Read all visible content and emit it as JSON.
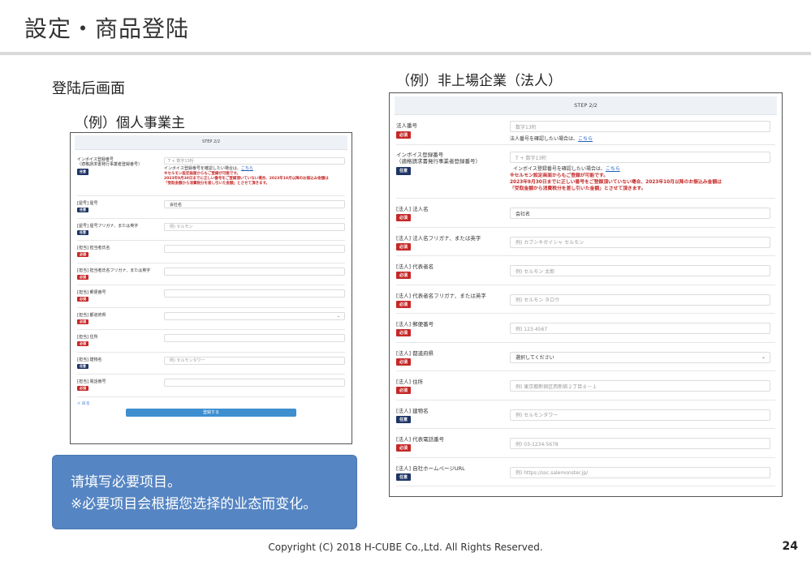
{
  "slide": {
    "title": "設定・商品登陆",
    "subtitle": "登陆后画面",
    "left_caption": "（例）個人事業主",
    "right_caption": "（例）非上場企業（法人）",
    "callout_line1": "请填写必要项目。",
    "callout_line2": "※必要项目会根据您选择的业态而变化。",
    "copyright": "Copyright (C) 2018 H-CUBE Co.,Ltd. All Rights Reserved.",
    "page_number": "24"
  },
  "individual_form": {
    "step": "STEP 2/2",
    "invoice": {
      "label1": "インボイス登録番号",
      "label2": "（適格請求書発行事業者登録番号）",
      "badge": "任意",
      "placeholder": "T + 数字13桁",
      "note": "インボイス登録番号を確認したい場合は、",
      "link": "こちら",
      "warn1": "※セルモン設定画面からもご登録が可能です。",
      "warn2": "2023年9月30日までに正しい番号をご登録頂いていない場合、2023年10月以降のお振込み金額は",
      "warn3": "「受取金額から消費税分を差し引いた金額」とさせて頂きます。"
    },
    "fields": [
      {
        "label": "[屋号] 屋号",
        "badge": "任意",
        "value": "会社名",
        "filled": true
      },
      {
        "label": "[屋号] 屋号フリガナ、または英字",
        "badge": "任意",
        "value": "例) セルモン",
        "filled": false
      },
      {
        "label": "[担当] 担当者氏名",
        "badge": "必須",
        "value": "",
        "filled": false
      },
      {
        "label": "[担当] 担当者氏名フリガナ、または英字",
        "badge": "必須",
        "value": "",
        "filled": false
      },
      {
        "label": "[担当] 郵便番号",
        "badge": "必須",
        "value": "",
        "filled": false
      },
      {
        "label": "[担当] 都道府県",
        "badge": "必須",
        "value": "",
        "filled": false,
        "select": true
      },
      {
        "label": "[担当] 住所",
        "badge": "必須",
        "value": "",
        "filled": false
      },
      {
        "label": "[担当] 建物名",
        "badge": "任意",
        "value": "例) セルモンタワー",
        "filled": false
      },
      {
        "label": "[担当] 電話番号",
        "badge": "必須",
        "value": "",
        "filled": false
      }
    ],
    "back": "< 戻る",
    "submit": "登録する"
  },
  "corporate_form": {
    "step": "STEP 2/2",
    "corp_number": {
      "label": "法人番号",
      "badge": "必須",
      "placeholder": "数字13桁",
      "note": "法人番号を確認したい場合は、",
      "link": "こちら"
    },
    "invoice": {
      "label1": "インボイス登録番号",
      "label2": "（適格請求書発行事業者登録番号）",
      "badge": "任意",
      "placeholder": "T + 数字13桁",
      "note": "インボイス登録番号を確認したい場合は、",
      "link": "こちら",
      "warn1": "※セルモン設定画面からもご登録が可能です。",
      "warn2": "2023年9月30日までに正しい番号をご登録頂いていない場合、2023年10月以降のお振込み金額は",
      "warn3": "「受取金額から消費税分を差し引いた金額」とさせて頂きます。"
    },
    "fields": [
      {
        "label": "[法人] 法人名",
        "badge": "必須",
        "value": "会社名",
        "filled": true
      },
      {
        "label": "[法人] 法人名フリガナ、または英字",
        "badge": "必須",
        "value": "例) カブシキガイシャ セルモン",
        "filled": false
      },
      {
        "label": "[法人] 代表者名",
        "badge": "必須",
        "value": "例) セルモン 太郎",
        "filled": false
      },
      {
        "label": "[法人] 代表者名フリガナ、または英字",
        "badge": "必須",
        "value": "例) セルモン タロウ",
        "filled": false
      },
      {
        "label": "[法人] 郵便番号",
        "badge": "必須",
        "value": "例) 123-4567",
        "filled": false
      },
      {
        "label": "[法人] 都道府県",
        "badge": "必須",
        "value": "選択してください",
        "filled": true,
        "select": true
      },
      {
        "label": "[法人] 住所",
        "badge": "必須",
        "value": "例) 東京都新宿区西新宿２丁目８－１",
        "filled": false
      },
      {
        "label": "[法人] 建物名",
        "badge": "任意",
        "value": "例) セルモンタワー",
        "filled": false
      },
      {
        "label": "[法人] 代表電話番号",
        "badge": "必須",
        "value": "例) 03-1234-5678",
        "filled": false
      },
      {
        "label": "[法人] 自社ホームページURL",
        "badge": "任意",
        "value": "例) https://ssc.salemonster.jp/",
        "filled": false
      }
    ]
  }
}
